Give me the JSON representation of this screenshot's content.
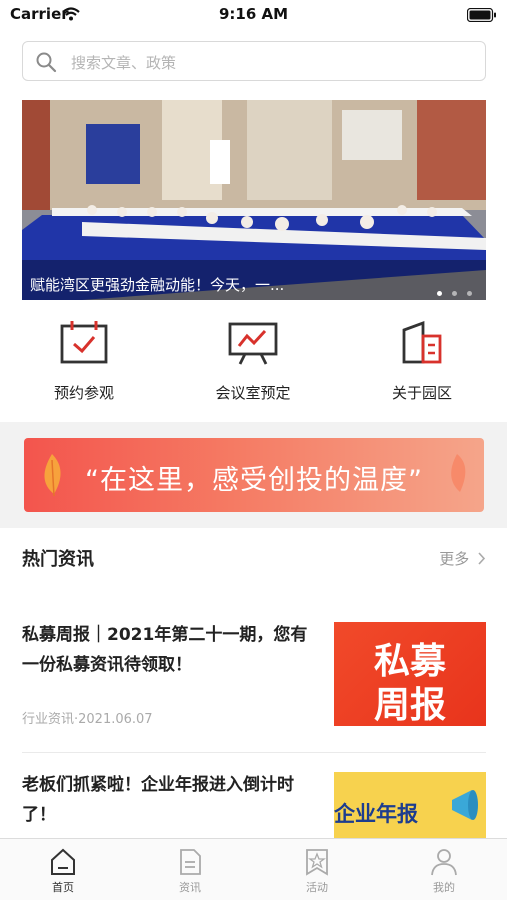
{
  "status_bar": {
    "carrier": "Carrier",
    "time": "9:16 AM"
  },
  "search": {
    "placeholder": "搜索文章、政策"
  },
  "banner": {
    "caption": "赋能湾区更强劲金融动能！今天，一...",
    "dot_count": 3,
    "active_dot": 1
  },
  "quick_actions": [
    {
      "label": "预约参观",
      "icon": "calendar-check-icon"
    },
    {
      "label": "会议室预定",
      "icon": "presentation-board-icon"
    },
    {
      "label": "关于园区",
      "icon": "buildings-icon"
    }
  ],
  "slogan": {
    "text": "“在这里，感受创投的温度”"
  },
  "hot_news": {
    "title": "热门资讯",
    "more": "更多",
    "items": [
      {
        "headline": "私募周报｜2021年第二十一期，您有一份私募资讯待领取！",
        "meta": "行业资讯·2021.06.07",
        "thumb_text": [
          "私募",
          "周报"
        ]
      },
      {
        "headline": "老板们抓紧啦！企业年报进入倒计时了！",
        "thumb_text": "企业年报"
      }
    ]
  },
  "tabbar": [
    {
      "label": "首页",
      "icon": "home-icon",
      "active": true
    },
    {
      "label": "资讯",
      "icon": "document-icon",
      "active": false
    },
    {
      "label": "活动",
      "icon": "badge-star-icon",
      "active": false
    },
    {
      "label": "我的",
      "icon": "person-icon",
      "active": false
    }
  ],
  "colors": {
    "accent": "#d8322c",
    "banner_overlay": "#000000",
    "slogan_start": "#f3554d"
  }
}
